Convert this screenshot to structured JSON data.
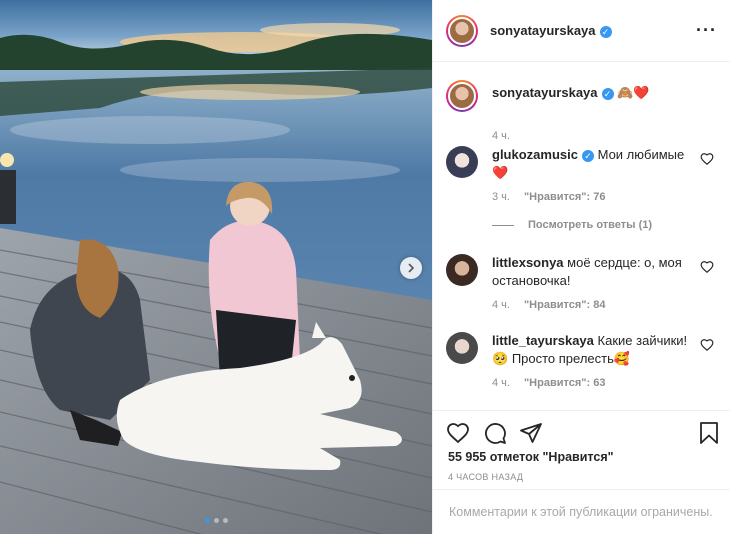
{
  "post": {
    "author": "sonyatayurskaya",
    "caption_emoji": "🙈❤️",
    "caption_time": "4 ч.",
    "likes_text": "55 955 отметок \"Нравится\"",
    "time_ago": "4 ЧАСОВ НАЗАД",
    "comments_closed": "Комментарии к этой публикации ограничены.",
    "carousel": {
      "count": 3,
      "active": 1
    }
  },
  "comments": [
    {
      "username": "glukozamusic",
      "verified": true,
      "text": "Мои любимые",
      "emoji": "❤️",
      "time": "3 ч.",
      "likes": "\"Нравится\": 76"
    },
    {
      "username": "littlexsonya",
      "verified": false,
      "text": "моё сердце: о, моя остановочка!",
      "time": "4 ч.",
      "likes": "\"Нравится\": 84"
    },
    {
      "username": "little_tayurskaya",
      "verified": false,
      "text": "Какие зайчики!",
      "text2": "Просто прелесть",
      "emoji_a": "🥺",
      "emoji_b": "🥰",
      "time": "4 ч.",
      "likes": "\"Нравится\": 63"
    }
  ],
  "replies_link": "Посмотреть ответы (1)",
  "icons": {
    "more": "more-options-icon",
    "verified": "verified-badge-icon",
    "like": "heart-icon",
    "comment": "comment-icon",
    "share": "share-icon",
    "save": "bookmark-icon",
    "next": "chevron-right-icon"
  },
  "colors": {
    "verified": "#3897f0",
    "muted": "#8e8e8e",
    "text": "#262626"
  }
}
